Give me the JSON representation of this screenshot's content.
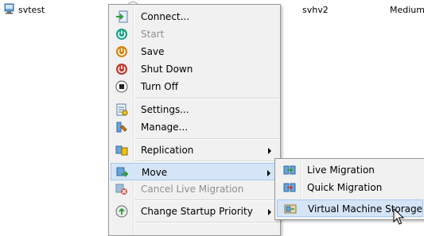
{
  "vm_row": {
    "name": "svtest",
    "host": "svhv2",
    "priority": "Medium"
  },
  "menu": {
    "items": [
      {
        "label": "Connect...",
        "icon": "connect-icon",
        "disabled": false
      },
      {
        "label": "Start",
        "icon": "start-icon",
        "disabled": true
      },
      {
        "label": "Save",
        "icon": "save-icon",
        "disabled": false
      },
      {
        "label": "Shut Down",
        "icon": "shutdown-icon",
        "disabled": false
      },
      {
        "label": "Turn Off",
        "icon": "turnoff-icon",
        "disabled": false
      },
      {
        "label": "Settings...",
        "icon": "settings-icon",
        "disabled": false
      },
      {
        "label": "Manage...",
        "icon": "manage-icon",
        "disabled": false
      },
      {
        "label": "Replication",
        "icon": "replication-icon",
        "disabled": false,
        "submenu": true
      },
      {
        "label": "Move",
        "icon": "move-icon",
        "disabled": false,
        "submenu": true,
        "highlighted": true
      },
      {
        "label": "Cancel Live Migration",
        "icon": "cancel-migration-icon",
        "disabled": true
      },
      {
        "label": "Change Startup Priority",
        "icon": "startup-priority-icon",
        "disabled": false,
        "submenu": true
      }
    ]
  },
  "submenu": {
    "items": [
      {
        "label": "Live Migration",
        "icon": "live-migration-icon"
      },
      {
        "label": "Quick Migration",
        "icon": "quick-migration-icon"
      },
      {
        "label": "Virtual Machine Storage",
        "icon": "vm-storage-icon",
        "highlighted": true
      }
    ]
  },
  "colors": {
    "highlight": "#d5e5f7",
    "highlight_border": "#a8c8ec",
    "menu_bg": "#f1f1f1"
  }
}
